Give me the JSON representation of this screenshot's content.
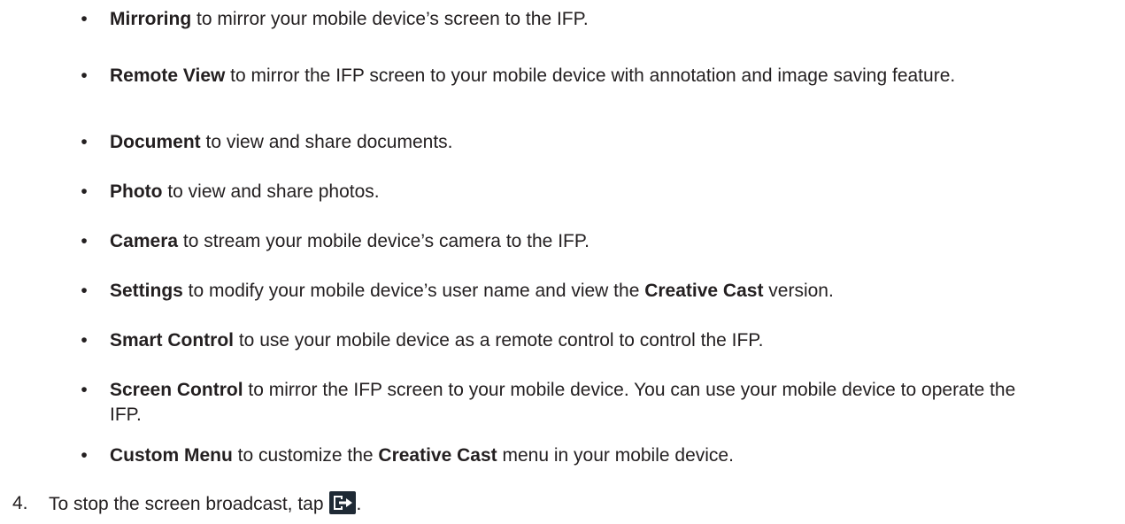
{
  "bullets": [
    {
      "term": "Mirroring",
      "rest": " to mirror your mobile device’s screen to the IFP."
    },
    {
      "term": "Remote View",
      "rest": " to mirror the IFP screen to your mobile device with annotation and image saving feature."
    },
    {
      "term": "Document",
      "rest": " to view and share documents."
    },
    {
      "term": "Photo",
      "rest": " to view and share photos."
    },
    {
      "term": "Camera",
      "rest": " to stream your mobile device’s camera to the IFP."
    },
    {
      "term": "Settings",
      "rest": " to modify your mobile device’s user name and view the ",
      "term2": "Creative Cast",
      "rest2": " version."
    },
    {
      "term": "Smart Control",
      "rest": " to use your mobile device as a remote control to control the IFP."
    },
    {
      "term": "Screen Control",
      "rest": " to mirror the IFP screen to your mobile device. You can use your mobile device to operate the IFP."
    },
    {
      "term": "Custom Menu",
      "rest": " to customize the ",
      "term2": "Creative Cast",
      "rest2": " menu in your mobile device."
    }
  ],
  "bullet_char": "•",
  "step": {
    "number": "4.",
    "text": "To stop the screen broadcast, tap",
    "end": ".",
    "icon": "exit-broadcast-icon"
  },
  "colors": {
    "text": "#231f20",
    "icon_bg": "#1f2a35",
    "icon_fg": "#ffffff"
  }
}
